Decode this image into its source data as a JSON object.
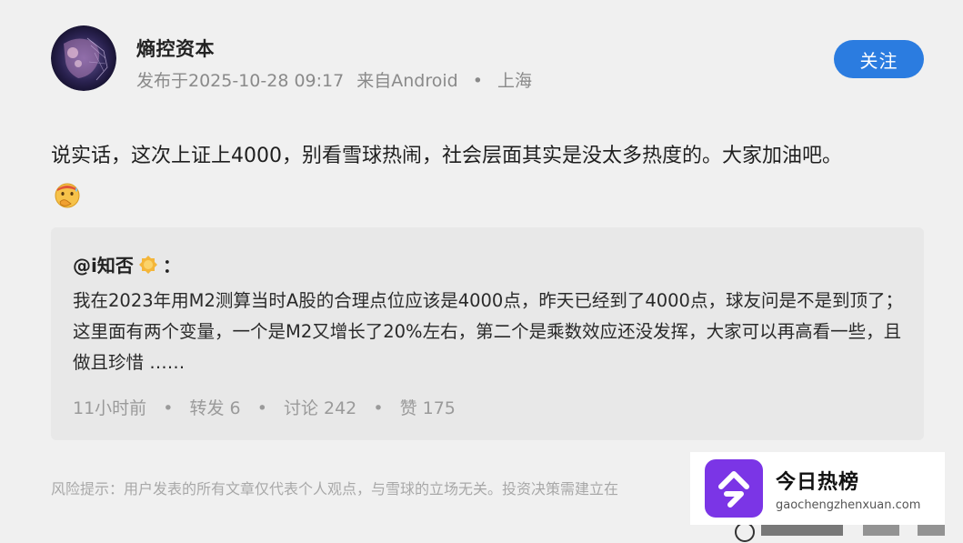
{
  "author": {
    "name": "熵控资本",
    "meta": {
      "published": "发布于2025-10-28 09:17",
      "source": "来自Android",
      "location": "上海"
    },
    "follow_label": "关注"
  },
  "post": {
    "text": "说实话，这次上证上4000，别看雪球热闹，社会层面其实是没太多热度的。大家加油吧。",
    "emoji": "sweating-hand-over-mouth-emoji"
  },
  "quote": {
    "author": "@i知否",
    "colon": "：",
    "text": "我在2023年用M2测算当时A股的合理点位应该是4000点，昨天已经到了4000点，球友问是不是到顶了；这里面有两个变量，一个是M2又增长了20%左右，第二个是乘数效应还没发挥，大家可以再高看一些，且做且珍惜 ……",
    "time": "11小时前",
    "repost": "转发 6",
    "comments": "讨论 242",
    "likes": "赞 175"
  },
  "disclaimer": "风险提示：用户发表的所有文章仅代表个人观点，与雪球的立场无关。投资决策需建立在",
  "watermark": {
    "title": "今日热榜",
    "url": "gaochengzhenxuan.com"
  },
  "colors": {
    "accent": "#2b7ce0",
    "watermark_brand": "#7b35e6"
  }
}
